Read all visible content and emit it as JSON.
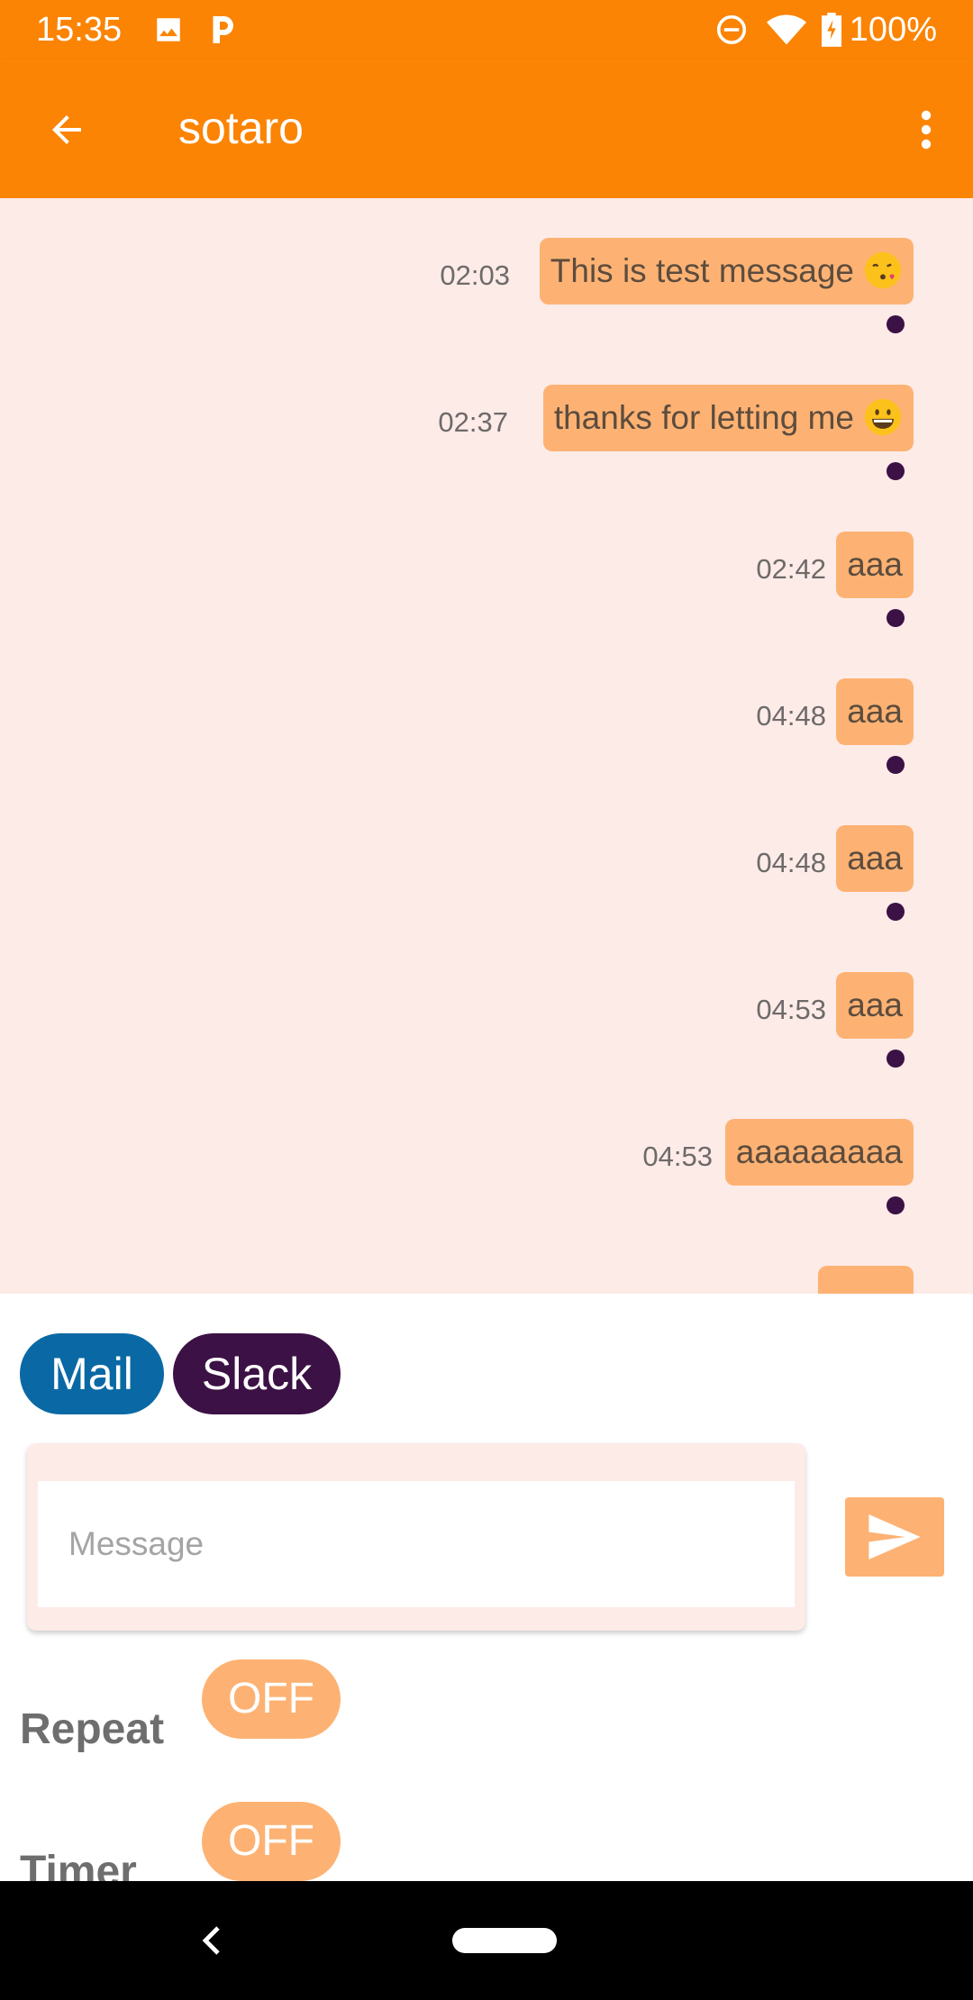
{
  "status_bar": {
    "time": "15:35",
    "battery_percent": "100%",
    "icons": [
      "image-icon",
      "parking-icon",
      "dnd-icon",
      "wifi-icon",
      "battery-icon"
    ]
  },
  "app_bar": {
    "title": "sotaro",
    "back_icon": "arrow-back-icon",
    "overflow_icon": "more-vert-icon"
  },
  "messages": [
    {
      "text": "This is test message",
      "emoji": "kissing-face-emoji",
      "time": "02:03"
    },
    {
      "text": "thanks for letting me",
      "emoji": "grinning-face-emoji",
      "time": "02:37"
    },
    {
      "text": "aaa",
      "time": "02:42"
    },
    {
      "text": "aaa",
      "time": "04:48"
    },
    {
      "text": "aaa",
      "time": "04:48"
    },
    {
      "text": "aaa",
      "time": "04:53"
    },
    {
      "text": "aaaaaaaaa",
      "time": "04:53"
    },
    {
      "text": "",
      "time": ""
    }
  ],
  "channels": {
    "mail_label": "Mail",
    "slack_label": "Slack",
    "mail_color": "#0a69a4",
    "slack_color": "#3c1145"
  },
  "composer": {
    "placeholder": "Message",
    "value": "",
    "send_icon": "send-icon"
  },
  "options": {
    "repeat_label": "Repeat",
    "repeat_state": "OFF",
    "timer_label": "Timer",
    "timer_state": "OFF"
  },
  "colors": {
    "accent": "#fb8404",
    "bubble": "#fdb273",
    "chat_background": "#fdebe8",
    "read_dot": "#3c1145"
  }
}
